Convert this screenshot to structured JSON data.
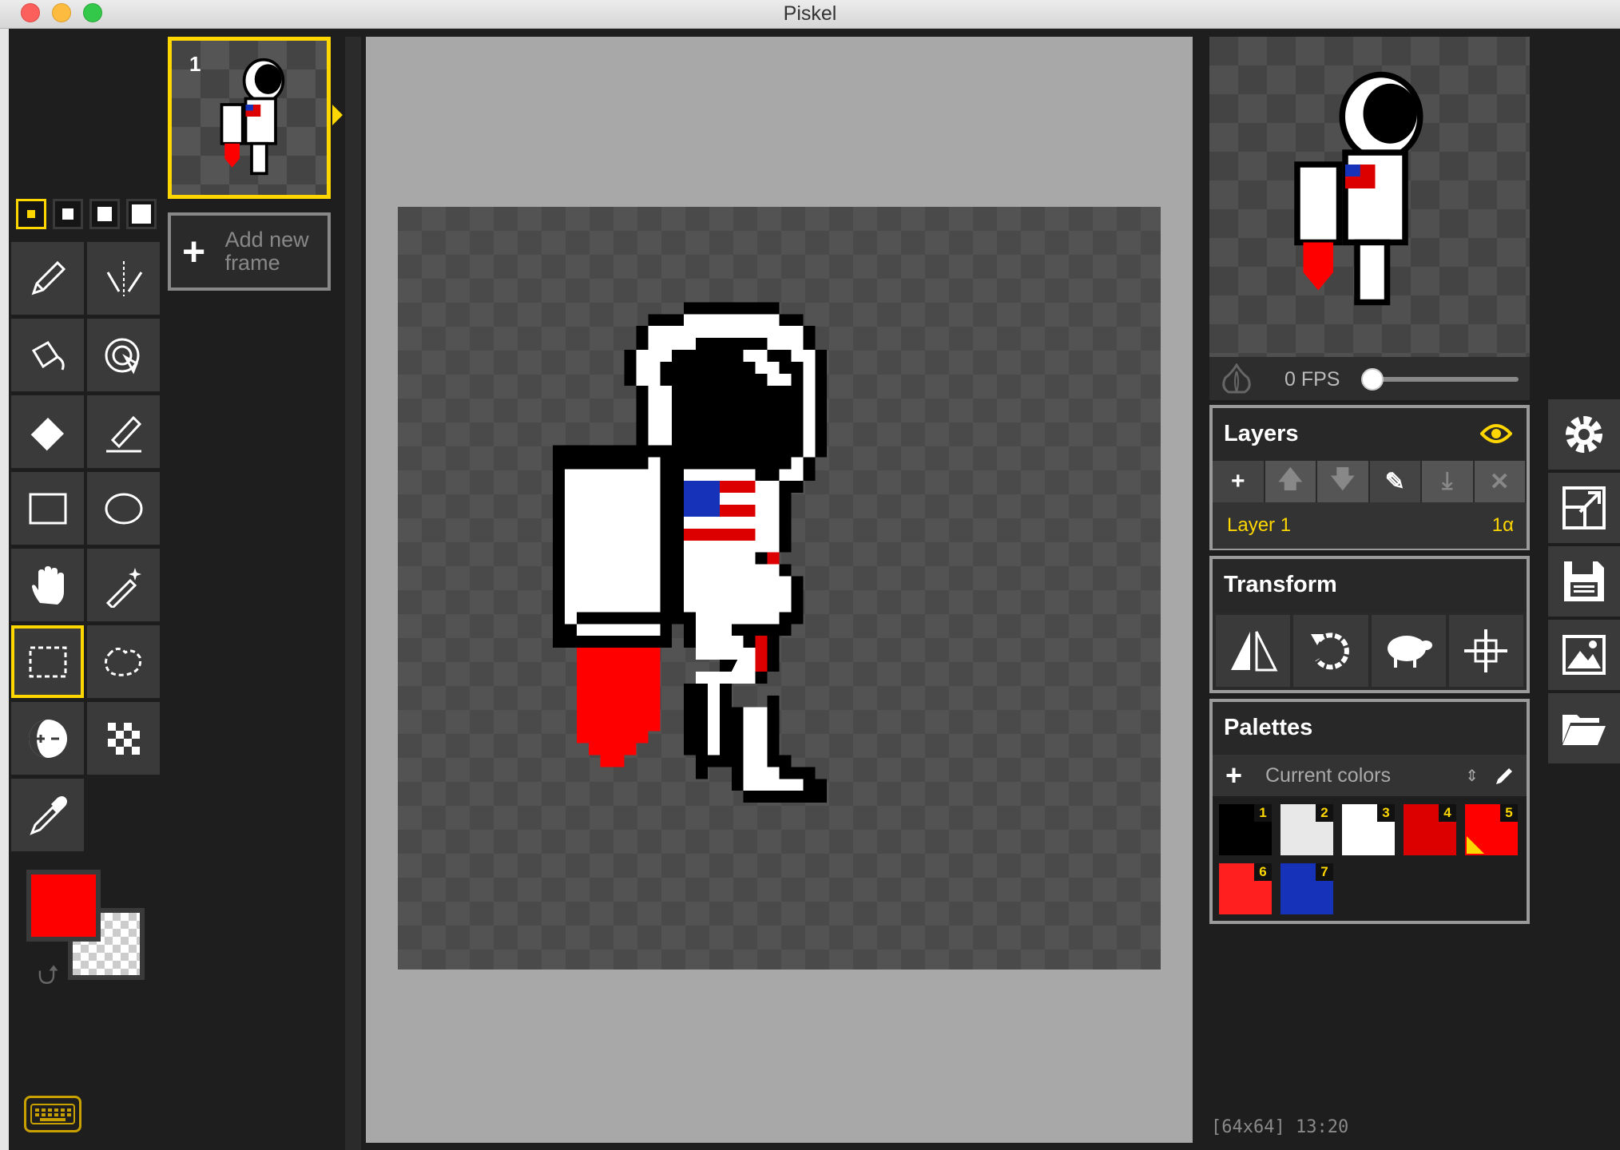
{
  "window": {
    "title": "Piskel"
  },
  "tools": {
    "pen_sizes": [
      1,
      2,
      3,
      4
    ],
    "selected_tool": "rectangle-select",
    "primary_color": "#ff0000",
    "secondary_color": "transparent"
  },
  "frames": {
    "items": [
      {
        "number": "1"
      }
    ],
    "add_label": "Add new frame"
  },
  "preview": {
    "fps": "0 FPS",
    "fps_value": 0
  },
  "layers": {
    "title": "Layers",
    "items": [
      {
        "name": "Layer 1",
        "opacity": "1α"
      }
    ]
  },
  "transform": {
    "title": "Transform"
  },
  "palettes": {
    "title": "Palettes",
    "selected": "Current colors",
    "colors": [
      {
        "index": "1",
        "color": "#000000"
      },
      {
        "index": "2",
        "color": "#e8e8e8"
      },
      {
        "index": "3",
        "color": "#ffffff"
      },
      {
        "index": "4",
        "color": "#dd0000"
      },
      {
        "index": "5",
        "color": "#ff0000"
      },
      {
        "index": "6",
        "color": "#ff1f1f"
      },
      {
        "index": "7",
        "color": "#1532b8"
      }
    ],
    "selected_index": 5
  },
  "status": {
    "text": "[64x64] 13:20"
  },
  "accent_color": "#ffd700"
}
